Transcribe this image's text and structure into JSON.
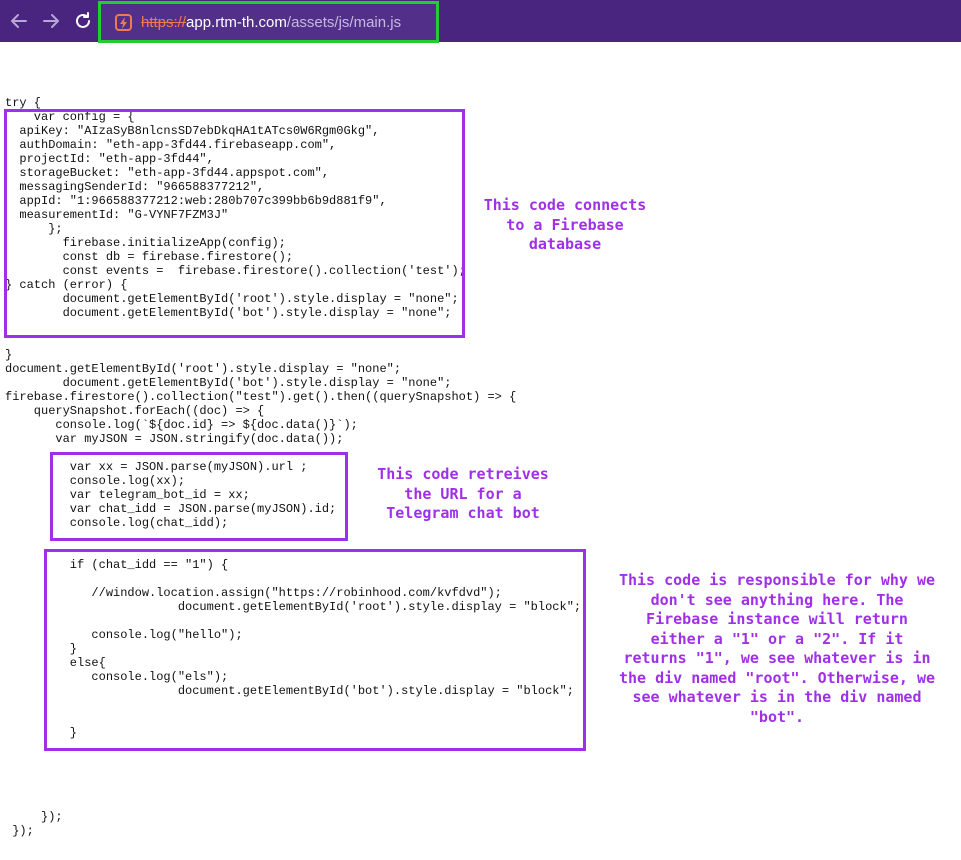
{
  "browser": {
    "url_scheme": "https://",
    "url_host": "app.rtm-th.com",
    "url_path": "/assets/js/main.js"
  },
  "code_lines": [
    "try {",
    "    var config = {",
    "  apiKey: \"AIzaSyB8nlcnsSD7ebDkqHA1tATcs0W6Rgm0Gkg\",",
    "  authDomain: \"eth-app-3fd44.firebaseapp.com\",",
    "  projectId: \"eth-app-3fd44\",",
    "  storageBucket: \"eth-app-3fd44.appspot.com\",",
    "  messagingSenderId: \"966588377212\",",
    "  appId: \"1:966588377212:web:280b707c399bb6b9d881f9\",",
    "  measurementId: \"G-VYNF7FZM3J\"",
    "      };",
    "        firebase.initializeApp(config);",
    "        const db = firebase.firestore();",
    "        const events =  firebase.firestore().collection('test');",
    "} catch (error) {",
    "        document.getElementById('root').style.display = \"none\";",
    "        document.getElementById('bot').style.display = \"none\";",
    "",
    "",
    "}",
    "document.getElementById('root').style.display = \"none\";",
    "        document.getElementById('bot').style.display = \"none\";",
    "firebase.firestore().collection(\"test\").get().then((querySnapshot) => {",
    "    querySnapshot.forEach((doc) => {",
    "       console.log(`${doc.id} => ${doc.data()}`);",
    "       var myJSON = JSON.stringify(doc.data());",
    "",
    "         var xx = JSON.parse(myJSON).url ;",
    "         console.log(xx);",
    "         var telegram_bot_id = xx;",
    "         var chat_idd = JSON.parse(myJSON).id;",
    "         console.log(chat_idd);",
    "",
    "",
    "         if (chat_idd == \"1\") {",
    "",
    "            //window.location.assign(\"https://robinhood.com/kvfdvd\");",
    "                        document.getElementById('root').style.display = \"block\";",
    "",
    "            console.log(\"hello\");",
    "         }",
    "         else{",
    "            console.log(\"els\");",
    "                        document.getElementById('bot').style.display = \"block\";",
    "",
    "",
    "         }",
    "",
    "",
    "",
    "",
    "",
    "     });",
    " });"
  ],
  "annotations": {
    "firebase": [
      "This code connects",
      "to a Firebase",
      "database"
    ],
    "telegram": [
      "This code retreives",
      "the URL for a",
      "Telegram chat bot"
    ],
    "logic": [
      "This code is responsible for why we",
      "don't see anything here. The",
      "Firebase instance will return",
      "either a \"1\" or a \"2\". If it",
      "returns \"1\", we see whatever is in",
      "the div named \"root\". Otherwise, we",
      "see whatever is in the div named",
      "\"bot\"."
    ]
  },
  "colors": {
    "browser_bar": "#4a2580",
    "url_highlight": "#22cc33",
    "annotation": "#a030e8",
    "insecure_scheme": "#ee7a52"
  }
}
